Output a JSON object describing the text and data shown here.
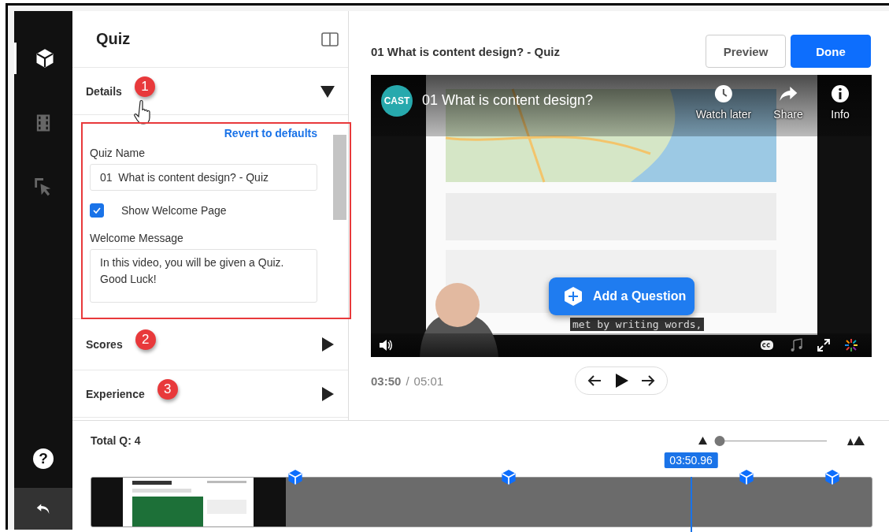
{
  "sidebar": {
    "items": [
      {
        "kind": "cube",
        "selected": true
      },
      {
        "kind": "film",
        "selected": false
      },
      {
        "kind": "pointer",
        "selected": false
      }
    ],
    "footer": [
      {
        "kind": "help",
        "glyph": "?"
      },
      {
        "kind": "back"
      }
    ]
  },
  "panel": {
    "title": "Quiz",
    "sections": [
      {
        "label": "Details",
        "badge": "1",
        "expanded": true,
        "hovered": true
      },
      {
        "label": "Scores",
        "badge": "2",
        "expanded": false,
        "hovered": false
      },
      {
        "label": "Experience",
        "badge": "3",
        "expanded": false,
        "hovered": false
      }
    ],
    "details": {
      "revert_link": "Revert to defaults",
      "quiz_name_label": "Quiz Name",
      "quiz_name": "01  What is content design? - Quiz",
      "show_welcome": {
        "label": "Show Welcome Page",
        "checked": true
      },
      "welcome_label": "Welcome Message",
      "welcome_message": "In this video, you will be given a Quiz.\nGood Luck!"
    }
  },
  "main": {
    "title": "01 What is content design? - Quiz",
    "buttons": [
      {
        "label": "Preview",
        "kind": "secondary"
      },
      {
        "label": "Done",
        "kind": "primary"
      }
    ],
    "video": {
      "channel": "CAST",
      "title": "01 What is content design?",
      "actions": [
        {
          "kind": "clock",
          "label": "Watch later"
        },
        {
          "kind": "share",
          "label": "Share"
        },
        {
          "kind": "info",
          "label": "Info"
        }
      ],
      "caption": "met by writing words,",
      "add_question": "Add a Question"
    },
    "time": {
      "current": "03:50",
      "separator": "/",
      "total": "05:01"
    }
  },
  "timeline": {
    "total": "Total Q: 4",
    "zoom": {
      "level": 0.04
    },
    "markers": [
      {
        "kind": "question"
      },
      {
        "kind": "question"
      },
      {
        "kind": "question"
      },
      {
        "kind": "question"
      }
    ],
    "playhead": {
      "time": "03:50.96",
      "level": 0.768
    }
  }
}
